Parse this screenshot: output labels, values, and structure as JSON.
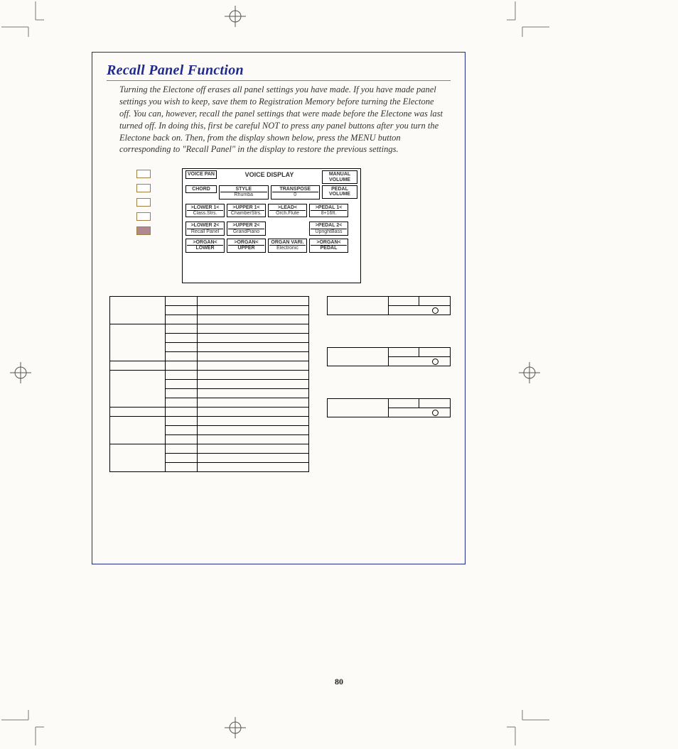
{
  "title": "Recall Panel Function",
  "body": "Turning the Electone off erases all panel settings you have made.  If you have made panel settings you wish to keep, save them to Registration Memory before turning the Electone off.  You can, however, recall the panel settings that were made before the Electone was last turned off.  In doing this, first be careful NOT to press any panel buttons after you turn the Electone back on.  Then, from the display shown below, press the MENU button corresponding to \"Recall Panel\" in the display to restore the previous settings.",
  "lcd": {
    "voice_pan": "VOICE PAN",
    "voice_display": "VOICE DISPLAY",
    "manual_volume": "MANUAL VOLUME",
    "chord": "CHORD",
    "style": "STYLE",
    "style_val": "Rhumba",
    "transpose": "TRANSPOSE",
    "transpose_val": "0",
    "pedal_volume": "PEDAL VOLUME",
    "lower1": ">LOWER 1<",
    "lower1_val": "Class.Strs.",
    "upper1": ">UPPER 1<",
    "upper1_val": "ChamberStrs.",
    "lead": ">LEAD<",
    "lead_val": "Orch.Flute",
    "pedal1": ">PEDAL 1<",
    "pedal1_val": "8+16ft.",
    "lower2": ">LOWER 2<",
    "recall_panel": "Recall Panel",
    "upper2": ">UPPER 2<",
    "upper2_val": "GrandPiano",
    "pedal2": ">PEDAL 2<",
    "pedal2_val": "UprightBass",
    "organ_l": ">ORGAN<",
    "lower": "LOWER",
    "organ_u": ">ORGAN<",
    "upper": "UPPER",
    "organ_vari": "ORGAN VARI.",
    "electronic": "Electronic",
    "organ_p": ">ORGAN<",
    "pedal": "PEDAL"
  },
  "page_number": "80"
}
